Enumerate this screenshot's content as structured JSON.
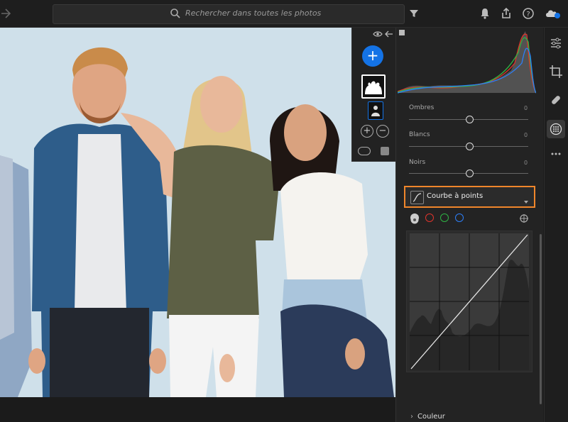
{
  "search": {
    "placeholder": "Rechercher dans toutes les photos"
  },
  "toolbar": {
    "icons": [
      "back-arrow-icon",
      "search-icon",
      "filter-icon",
      "bell-icon",
      "share-icon",
      "help-icon",
      "cloud-sync-icon"
    ]
  },
  "mask_panel": {
    "add_label": "+",
    "add_minus": [
      "+",
      "−"
    ]
  },
  "light_sliders": [
    {
      "label": "Ombres",
      "value": "0",
      "position": 0.5
    },
    {
      "label": "Blancs",
      "value": "0",
      "position": 0.5
    },
    {
      "label": "Noirs",
      "value": "0",
      "position": 0.5
    }
  ],
  "curve": {
    "title": "Courbe à points",
    "channels": [
      "rgb",
      "red",
      "green",
      "blue"
    ]
  },
  "sections": {
    "couleur": "Couleur"
  },
  "colors": {
    "accent": "#1473e6",
    "highlight": "#f0862b",
    "red": "#e0342c",
    "green": "#2fb344",
    "blue": "#2d7ff9"
  },
  "rail": {
    "icons": [
      "edit-sliders-icon",
      "crop-icon",
      "healing-icon",
      "masking-icon",
      "more-icon"
    ]
  }
}
